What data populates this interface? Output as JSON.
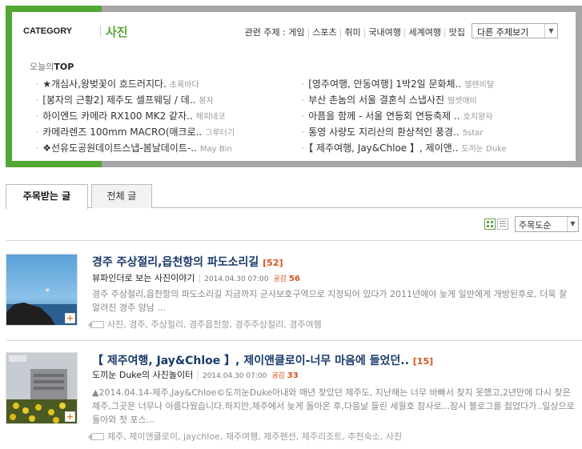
{
  "category": {
    "label": "CATEGORY",
    "name": "사진",
    "related_label": "관련 주제 :",
    "related_topics": [
      "게임",
      "스포츠",
      "취미",
      "국내여행",
      "세계여행",
      "맛집"
    ],
    "topic_select": "다른 주제보기"
  },
  "today_top": {
    "prefix": "오늘의",
    "label": "TOP",
    "left": [
      {
        "title": "★개심사,왕벚꽃이 흐드러지다.",
        "source": "초록바다"
      },
      {
        "title": "[봉자의 근황2] 제주도 셀프웨딩 / 데..",
        "source": "봉자"
      },
      {
        "title": "하이엔드 카메라 RX100 MK2 같자..",
        "source": "해피네코"
      },
      {
        "title": "카메라렌즈 100mm MACRO(매크로..",
        "source": "그루터기"
      },
      {
        "title": "❖선유도공원데이트스냅-봄날데이트-..",
        "source": "May Bin"
      }
    ],
    "right": [
      {
        "title": "[영주여행, 안동여행] 1박2일 문화체..",
        "source": "엘렌비탈"
      },
      {
        "title": "부산 촌놈의 서울 결혼식 스냅사진",
        "source": "딸셋애비"
      },
      {
        "title": "아픔을 함께 - 서울 연등회 연등축제 ..",
        "source": "호치왕자"
      },
      {
        "title": "통영 사량도 지리산의 환상적인 풍경..",
        "source": "5star"
      },
      {
        "title": "【 제주여행, Jay&Chloe 】, 제이앤..",
        "source": "도끼눈 Duke"
      }
    ]
  },
  "tabs": [
    "주목받는 글",
    "전체 글"
  ],
  "sort_select": "주목도순",
  "posts": [
    {
      "title": "경주 주상절리,읍천항의 파도소리길",
      "count": "[52]",
      "blog": "뷰파인더로 보는 사진이야기",
      "date": "2014.04.30 07:00",
      "like_label": "공감",
      "like_count": "56",
      "body": "경주 주상절리,읍천항의 파도소리길          지금까지 군사보호구역으로 지정되어 있다가 2011년에야 늦게  일반에게 개방된후로, 더욱 잘 알려진 경주 양남 ...",
      "tags": "사진, 경주, 주상절리, 경주읍천항, 경주주상절리, 경주여행"
    },
    {
      "title": "【 제주여행, Jay&Chloe 】, 제이앤클로이-너무 마음에 들었던..",
      "count": "[15]",
      "blog": "도끼눈 Duke의 사진놀이터",
      "date": "2014.04.30 07:00",
      "like_label": "공감",
      "like_count": "33",
      "body": "▲2014.04.14-제주,Jay&Chloe©도끼눈Duke아내와 매년 찾았던 제주도, 지난해는 너무 바빠서 찾지 못했고,2년만에 다시 찾은 제주,그곳은 너무나 아름다웠습니다.하지만,제주에서 늦게 돌아온 후,다음날 들린 세월호 참사로...잠시 블로그를 접었다가..일상으로 돌아와 첫 포스...",
      "tags": "제주, 제이앤클로이, jaychloe, 제주여행, 제주펜션, 제주리조트, 추천숙소, 사진"
    }
  ],
  "icons": {
    "view_grid": "grid-view-icon",
    "view_list": "list-view-icon",
    "plus": "plus-icon",
    "tag": "tag-icon",
    "dropdown": "chevron-down-icon"
  },
  "colors": {
    "accent_green": "#53a735",
    "frame_gray": "#a6a6a6",
    "title_blue": "#1a3a6b",
    "count_orange": "#d4531f"
  }
}
